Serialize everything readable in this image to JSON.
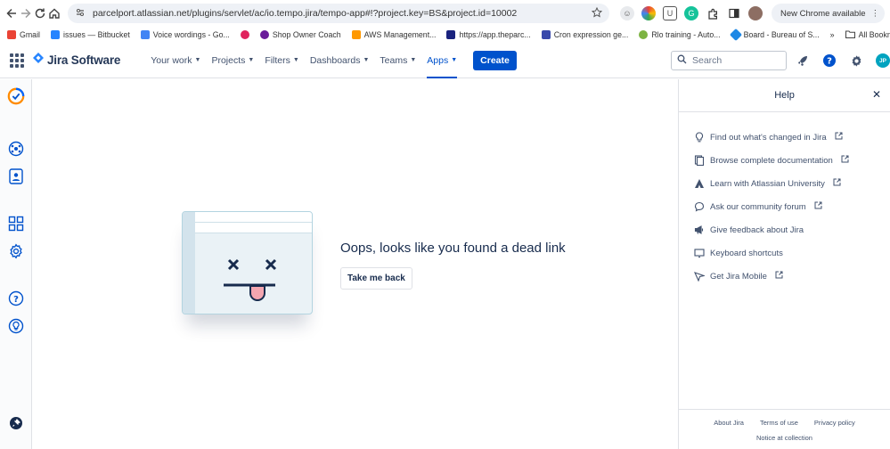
{
  "browser": {
    "url": "parcelport.atlassian.net/plugins/servlet/ac/io.tempo.jira/tempo-app#!?project.key=BS&project.id=10002",
    "new_chrome_label": "New Chrome available"
  },
  "bookmarks": {
    "items": [
      {
        "label": "Gmail",
        "color": "#ea4335"
      },
      {
        "label": "issues — Bitbucket",
        "color": "#2684ff"
      },
      {
        "label": "Voice wordings - Go...",
        "color": "#4285f4"
      },
      {
        "label": "",
        "color": "#e0245e"
      },
      {
        "label": "Shop Owner Coach",
        "color": "#6a1b9a"
      },
      {
        "label": "AWS Management...",
        "color": "#ff9900"
      },
      {
        "label": "https://app.theparc...",
        "color": "#1a237e"
      },
      {
        "label": "Cron expression ge...",
        "color": "#3949ab"
      },
      {
        "label": "Rlo training - Auto...",
        "color": "#7cb342"
      },
      {
        "label": "Board - Bureau of S...",
        "color": "#1e88e5"
      }
    ],
    "more": "»",
    "all_bookmarks": "All Bookmarks"
  },
  "jira": {
    "logo_text": "Jira Software",
    "menu": [
      {
        "label": "Your work",
        "active": false
      },
      {
        "label": "Projects",
        "active": false
      },
      {
        "label": "Filters",
        "active": false
      },
      {
        "label": "Dashboards",
        "active": false
      },
      {
        "label": "Teams",
        "active": false
      },
      {
        "label": "Apps",
        "active": true
      }
    ],
    "create_label": "Create",
    "search_placeholder": "Search",
    "avatar_initials": "JP"
  },
  "main": {
    "message": "Oops, looks like you found a dead link",
    "back_button": "Take me back"
  },
  "help": {
    "title": "Help",
    "items": [
      {
        "label": "Find out what's changed in Jira",
        "icon": "lightbulb-icon",
        "external": true
      },
      {
        "label": "Browse complete documentation",
        "icon": "document-icon",
        "external": true
      },
      {
        "label": "Learn with Atlassian University",
        "icon": "atlassian-icon",
        "external": true
      },
      {
        "label": "Ask our community forum",
        "icon": "chat-icon",
        "external": true
      },
      {
        "label": "Give feedback about Jira",
        "icon": "megaphone-icon",
        "external": false
      },
      {
        "label": "Keyboard shortcuts",
        "icon": "keyboard-icon",
        "external": false
      },
      {
        "label": "Get Jira Mobile",
        "icon": "send-icon",
        "external": true
      }
    ],
    "footer": {
      "about": "About Jira",
      "terms": "Terms of use",
      "privacy": "Privacy policy",
      "notice": "Notice at collection"
    }
  },
  "colors": {
    "accent": "#0052cc",
    "text": "#172b4d",
    "subtle": "#42526e"
  }
}
